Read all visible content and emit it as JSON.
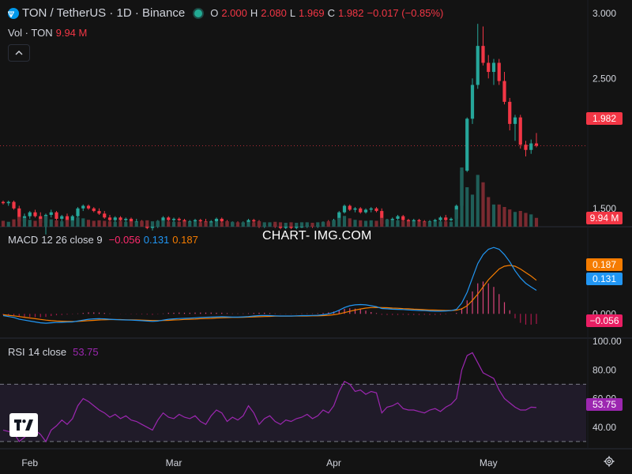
{
  "header": {
    "symbol": "TON / TetherUS · 1D · Binance",
    "open_label": "O",
    "open": "2.000",
    "high_label": "H",
    "high": "2.080",
    "low_label": "L",
    "low": "1.969",
    "close_label": "C",
    "close": "1.982",
    "change": "−0.017 (−0.85%)"
  },
  "volume_legend": {
    "label": "Vol · TON",
    "value": "9.94 M"
  },
  "macd_legend": {
    "label": "MACD",
    "params": "12 26 close 9",
    "hist": "−0.056",
    "macd": "0.131",
    "signal": "0.187"
  },
  "rsi_legend": {
    "label": "RSI",
    "params": "14 close",
    "value": "53.75"
  },
  "watermark": "CHART- IMG.COM",
  "tags": {
    "price": "1.982",
    "volume": "9.94 M",
    "macd_signal": "0.187",
    "macd_line": "0.131",
    "macd_hist": "−0.056",
    "rsi": "53.75"
  },
  "colors": {
    "up": "#26a69a",
    "down": "#f23645",
    "macd": "#2196f3",
    "signal": "#f57c00",
    "rsi": "#9c27b0",
    "background": "#131313",
    "grid": "#1e222d"
  },
  "icons": {
    "symbol_logo": "ton-logo",
    "status": "market-status-dot",
    "collapse": "chevron-up-icon",
    "brand": "tradingview-logo",
    "settings": "gear-icon"
  },
  "chart_data": {
    "type": "candlestick",
    "interval": "1D",
    "x_tick_labels": [
      "Feb",
      "Mar",
      "Apr",
      "May"
    ],
    "price_axis": {
      "ticks": [
        "3.000",
        "2.500",
        "1.500"
      ],
      "ylim": [
        1.28,
        3.0
      ]
    },
    "candles": [
      [
        1.55,
        1.56,
        1.53,
        1.54
      ],
      [
        1.54,
        1.56,
        1.52,
        1.55
      ],
      [
        1.55,
        1.56,
        1.49,
        1.5
      ],
      [
        1.5,
        1.52,
        1.37,
        1.4
      ],
      [
        1.4,
        1.46,
        1.38,
        1.44
      ],
      [
        1.44,
        1.48,
        1.42,
        1.47
      ],
      [
        1.47,
        1.49,
        1.43,
        1.44
      ],
      [
        1.44,
        1.47,
        1.37,
        1.39
      ],
      [
        1.39,
        1.46,
        1.3,
        1.45
      ],
      [
        1.45,
        1.49,
        1.43,
        1.47
      ],
      [
        1.47,
        1.48,
        1.41,
        1.42
      ],
      [
        1.42,
        1.45,
        1.4,
        1.44
      ],
      [
        1.44,
        1.46,
        1.38,
        1.4
      ],
      [
        1.4,
        1.45,
        1.39,
        1.44
      ],
      [
        1.44,
        1.51,
        1.43,
        1.5
      ],
      [
        1.5,
        1.53,
        1.48,
        1.52
      ],
      [
        1.52,
        1.53,
        1.49,
        1.5
      ],
      [
        1.5,
        1.51,
        1.47,
        1.48
      ],
      [
        1.48,
        1.5,
        1.45,
        1.46
      ],
      [
        1.46,
        1.48,
        1.42,
        1.43
      ],
      [
        1.43,
        1.45,
        1.4,
        1.41
      ],
      [
        1.41,
        1.44,
        1.39,
        1.43
      ],
      [
        1.43,
        1.44,
        1.4,
        1.41
      ],
      [
        1.41,
        1.43,
        1.39,
        1.42
      ],
      [
        1.42,
        1.43,
        1.38,
        1.39
      ],
      [
        1.39,
        1.42,
        1.37,
        1.4
      ],
      [
        1.4,
        1.41,
        1.36,
        1.37
      ],
      [
        1.37,
        1.39,
        1.34,
        1.35
      ],
      [
        1.35,
        1.37,
        1.33,
        1.36
      ],
      [
        1.36,
        1.41,
        1.35,
        1.4
      ],
      [
        1.4,
        1.44,
        1.39,
        1.43
      ],
      [
        1.43,
        1.44,
        1.4,
        1.41
      ],
      [
        1.41,
        1.43,
        1.39,
        1.42
      ],
      [
        1.42,
        1.43,
        1.4,
        1.41
      ],
      [
        1.41,
        1.42,
        1.38,
        1.39
      ],
      [
        1.39,
        1.41,
        1.37,
        1.4
      ],
      [
        1.4,
        1.42,
        1.38,
        1.41
      ],
      [
        1.41,
        1.42,
        1.39,
        1.4
      ],
      [
        1.4,
        1.42,
        1.38,
        1.39
      ],
      [
        1.39,
        1.41,
        1.38,
        1.4
      ],
      [
        1.4,
        1.43,
        1.39,
        1.42
      ],
      [
        1.42,
        1.43,
        1.39,
        1.4
      ],
      [
        1.4,
        1.41,
        1.36,
        1.37
      ],
      [
        1.37,
        1.4,
        1.36,
        1.39
      ],
      [
        1.39,
        1.4,
        1.37,
        1.38
      ],
      [
        1.38,
        1.4,
        1.37,
        1.39
      ],
      [
        1.39,
        1.42,
        1.38,
        1.41
      ],
      [
        1.41,
        1.42,
        1.39,
        1.4
      ],
      [
        1.4,
        1.41,
        1.35,
        1.36
      ],
      [
        1.36,
        1.38,
        1.35,
        1.37
      ],
      [
        1.37,
        1.39,
        1.36,
        1.38
      ],
      [
        1.38,
        1.39,
        1.35,
        1.36
      ],
      [
        1.36,
        1.37,
        1.34,
        1.35
      ],
      [
        1.35,
        1.37,
        1.34,
        1.36
      ],
      [
        1.36,
        1.37,
        1.34,
        1.35
      ],
      [
        1.35,
        1.37,
        1.34,
        1.36
      ],
      [
        1.36,
        1.37,
        1.35,
        1.36
      ],
      [
        1.36,
        1.38,
        1.35,
        1.37
      ],
      [
        1.37,
        1.38,
        1.35,
        1.36
      ],
      [
        1.36,
        1.38,
        1.35,
        1.37
      ],
      [
        1.37,
        1.4,
        1.36,
        1.39
      ],
      [
        1.39,
        1.41,
        1.36,
        1.37
      ],
      [
        1.37,
        1.42,
        1.36,
        1.41
      ],
      [
        1.41,
        1.48,
        1.4,
        1.47
      ],
      [
        1.47,
        1.53,
        1.46,
        1.52
      ],
      [
        1.52,
        1.53,
        1.48,
        1.49
      ],
      [
        1.49,
        1.51,
        1.47,
        1.5
      ],
      [
        1.5,
        1.51,
        1.46,
        1.47
      ],
      [
        1.47,
        1.5,
        1.46,
        1.49
      ],
      [
        1.49,
        1.51,
        1.47,
        1.5
      ],
      [
        1.5,
        1.51,
        1.47,
        1.48
      ],
      [
        1.48,
        1.5,
        1.37,
        1.38
      ],
      [
        1.38,
        1.42,
        1.37,
        1.41
      ],
      [
        1.41,
        1.43,
        1.39,
        1.42
      ],
      [
        1.42,
        1.45,
        1.41,
        1.44
      ],
      [
        1.44,
        1.45,
        1.4,
        1.41
      ],
      [
        1.41,
        1.42,
        1.39,
        1.4
      ],
      [
        1.4,
        1.42,
        1.39,
        1.41
      ],
      [
        1.41,
        1.42,
        1.39,
        1.4
      ],
      [
        1.4,
        1.41,
        1.38,
        1.39
      ],
      [
        1.39,
        1.41,
        1.38,
        1.4
      ],
      [
        1.4,
        1.42,
        1.39,
        1.41
      ],
      [
        1.41,
        1.44,
        1.4,
        1.43
      ],
      [
        1.43,
        1.45,
        1.4,
        1.41
      ],
      [
        1.41,
        1.43,
        1.4,
        1.42
      ],
      [
        1.42,
        1.53,
        1.41,
        1.52
      ],
      [
        1.52,
        1.8,
        1.51,
        1.79
      ],
      [
        1.79,
        2.2,
        1.78,
        2.19
      ],
      [
        2.19,
        2.5,
        2.15,
        2.45
      ],
      [
        2.45,
        2.92,
        2.42,
        2.75
      ],
      [
        2.75,
        2.9,
        2.6,
        2.62
      ],
      [
        2.62,
        2.68,
        2.5,
        2.55
      ],
      [
        2.55,
        2.65,
        2.45,
        2.62
      ],
      [
        2.62,
        2.65,
        2.45,
        2.48
      ],
      [
        2.48,
        2.55,
        2.3,
        2.32
      ],
      [
        2.32,
        2.35,
        2.1,
        2.15
      ],
      [
        2.15,
        2.22,
        2.02,
        2.2
      ],
      [
        2.2,
        2.22,
        1.96,
        1.99
      ],
      [
        1.99,
        2.02,
        1.9,
        1.95
      ],
      [
        1.95,
        2.03,
        1.92,
        2.0
      ],
      [
        2.0,
        2.08,
        1.97,
        1.982
      ]
    ],
    "volume": [
      1.2,
      1.0,
      1.5,
      2.0,
      1.8,
      1.4,
      1.2,
      1.6,
      2.2,
      1.5,
      1.3,
      1.1,
      1.4,
      1.3,
      1.9,
      1.7,
      1.4,
      1.2,
      1.3,
      1.2,
      1.1,
      1.0,
      1.2,
      1.0,
      1.1,
      1.0,
      1.2,
      1.3,
      1.1,
      1.2,
      1.3,
      1.1,
      1.0,
      1.0,
      1.1,
      1.0,
      1.0,
      0.9,
      1.0,
      0.9,
      1.0,
      0.9,
      1.1,
      1.0,
      0.9,
      0.9,
      1.0,
      0.9,
      1.1,
      0.9,
      0.9,
      1.0,
      0.9,
      0.8,
      0.9,
      0.8,
      0.9,
      0.9,
      0.8,
      0.9,
      1.0,
      1.1,
      1.3,
      1.8,
      2.2,
      1.7,
      1.4,
      1.3,
      1.2,
      1.3,
      1.2,
      1.8,
      1.5,
      1.3,
      1.3,
      1.2,
      1.1,
      1.1,
      1.0,
      1.0,
      1.0,
      1.0,
      1.1,
      1.1,
      1.0,
      3.5,
      12.0,
      8.0,
      6.5,
      10.5,
      9.0,
      6.0,
      4.5,
      4.5,
      4.0,
      3.5,
      3.0,
      3.2,
      2.8,
      2.5,
      1.8
    ],
    "macd": {
      "ylim": [
        -0.1,
        0.45
      ],
      "ticks": [
        "0.000"
      ],
      "macd_line": [
        -0.01,
        -0.015,
        -0.02,
        -0.03,
        -0.035,
        -0.04,
        -0.045,
        -0.05,
        -0.052,
        -0.05,
        -0.048,
        -0.047,
        -0.046,
        -0.045,
        -0.04,
        -0.035,
        -0.03,
        -0.028,
        -0.027,
        -0.028,
        -0.03,
        -0.032,
        -0.033,
        -0.034,
        -0.035,
        -0.036,
        -0.038,
        -0.04,
        -0.042,
        -0.04,
        -0.035,
        -0.03,
        -0.028,
        -0.026,
        -0.025,
        -0.024,
        -0.022,
        -0.02,
        -0.019,
        -0.018,
        -0.017,
        -0.016,
        -0.017,
        -0.018,
        -0.018,
        -0.017,
        -0.015,
        -0.012,
        -0.01,
        -0.009,
        -0.01,
        -0.011,
        -0.012,
        -0.012,
        -0.012,
        -0.011,
        -0.01,
        -0.01,
        -0.009,
        -0.008,
        -0.005,
        0.0,
        0.008,
        0.02,
        0.035,
        0.045,
        0.05,
        0.052,
        0.05,
        0.045,
        0.04,
        0.03,
        0.028,
        0.026,
        0.025,
        0.024,
        0.022,
        0.02,
        0.019,
        0.018,
        0.016,
        0.015,
        0.015,
        0.016,
        0.018,
        0.025,
        0.06,
        0.12,
        0.2,
        0.28,
        0.33,
        0.36,
        0.37,
        0.36,
        0.33,
        0.29,
        0.24,
        0.2,
        0.17,
        0.15,
        0.131
      ],
      "signal_line": [
        -0.005,
        -0.008,
        -0.011,
        -0.015,
        -0.019,
        -0.023,
        -0.027,
        -0.031,
        -0.035,
        -0.038,
        -0.04,
        -0.041,
        -0.042,
        -0.043,
        -0.042,
        -0.04,
        -0.038,
        -0.036,
        -0.034,
        -0.033,
        -0.032,
        -0.032,
        -0.032,
        -0.033,
        -0.033,
        -0.034,
        -0.035,
        -0.036,
        -0.037,
        -0.038,
        -0.037,
        -0.036,
        -0.034,
        -0.033,
        -0.031,
        -0.03,
        -0.029,
        -0.027,
        -0.026,
        -0.025,
        -0.023,
        -0.022,
        -0.021,
        -0.02,
        -0.02,
        -0.019,
        -0.018,
        -0.017,
        -0.016,
        -0.015,
        -0.014,
        -0.013,
        -0.013,
        -0.013,
        -0.013,
        -0.012,
        -0.012,
        -0.012,
        -0.011,
        -0.011,
        -0.01,
        -0.008,
        -0.005,
        0.0,
        0.007,
        0.014,
        0.021,
        0.027,
        0.032,
        0.035,
        0.036,
        0.035,
        0.034,
        0.032,
        0.031,
        0.029,
        0.028,
        0.026,
        0.025,
        0.023,
        0.022,
        0.021,
        0.02,
        0.019,
        0.019,
        0.02,
        0.028,
        0.045,
        0.075,
        0.11,
        0.15,
        0.19,
        0.22,
        0.25,
        0.265,
        0.27,
        0.265,
        0.25,
        0.23,
        0.21,
        0.187
      ],
      "histogram": [
        -0.005,
        -0.007,
        -0.009,
        -0.015,
        -0.016,
        -0.017,
        -0.018,
        -0.019,
        -0.017,
        -0.012,
        -0.008,
        -0.006,
        -0.004,
        -0.002,
        0.002,
        0.005,
        0.008,
        0.008,
        0.007,
        0.005,
        0.002,
        0.0,
        -0.001,
        -0.001,
        -0.002,
        -0.002,
        -0.003,
        -0.004,
        -0.005,
        -0.002,
        0.002,
        0.006,
        0.006,
        0.007,
        0.006,
        0.006,
        0.007,
        0.007,
        0.007,
        0.007,
        0.006,
        0.006,
        0.004,
        0.002,
        0.002,
        0.002,
        0.003,
        0.005,
        0.006,
        0.006,
        0.004,
        0.002,
        0.001,
        0.001,
        0.001,
        0.001,
        0.002,
        0.002,
        0.002,
        0.003,
        0.005,
        0.008,
        0.013,
        0.02,
        0.028,
        0.031,
        0.029,
        0.025,
        0.018,
        0.01,
        0.004,
        -0.005,
        -0.006,
        -0.006,
        -0.006,
        -0.005,
        -0.006,
        -0.006,
        -0.006,
        -0.005,
        -0.006,
        -0.006,
        -0.005,
        -0.003,
        -0.001,
        0.005,
        0.032,
        0.075,
        0.125,
        0.17,
        0.18,
        0.17,
        0.15,
        0.11,
        0.065,
        0.02,
        -0.025,
        -0.05,
        -0.06,
        -0.06,
        -0.056
      ]
    },
    "rsi": {
      "ylim": [
        25,
        100
      ],
      "ticks": [
        "100.00",
        "80.00",
        "60.00",
        "40.00"
      ],
      "bands": [
        70,
        30
      ],
      "values": [
        38,
        37,
        36,
        30,
        33,
        36,
        38,
        35,
        30,
        38,
        41,
        45,
        42,
        46,
        55,
        60,
        58,
        55,
        52,
        50,
        47,
        49,
        46,
        48,
        45,
        44,
        42,
        40,
        38,
        45,
        50,
        47,
        46,
        49,
        47,
        46,
        48,
        44,
        42,
        48,
        52,
        50,
        44,
        47,
        45,
        48,
        55,
        50,
        42,
        46,
        48,
        44,
        42,
        45,
        44,
        46,
        47,
        49,
        46,
        48,
        52,
        50,
        55,
        65,
        72,
        70,
        65,
        66,
        63,
        65,
        64,
        50,
        54,
        55,
        57,
        53,
        52,
        52,
        51,
        50,
        52,
        53,
        51,
        54,
        56,
        60,
        80,
        90,
        92,
        85,
        78,
        76,
        74,
        66,
        60,
        57,
        54,
        52,
        52,
        54,
        53.75
      ]
    }
  }
}
